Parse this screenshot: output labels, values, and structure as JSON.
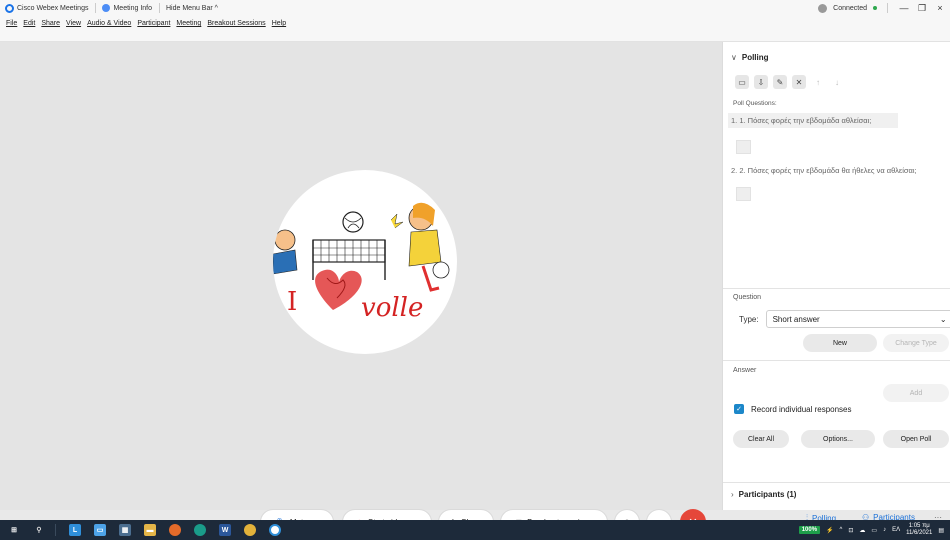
{
  "titlebar": {
    "app_name": "Cisco Webex Meetings",
    "meeting_info": "Meeting Info",
    "hide_menu": "Hide Menu Bar ^",
    "status": "Connected",
    "minimize": "—",
    "restore": "❐",
    "close": "×"
  },
  "menu": [
    "File",
    "Edit",
    "Share",
    "View",
    "Audio & Video",
    "Participant",
    "Meeting",
    "Breakout Sessions",
    "Help"
  ],
  "polling": {
    "title": "Polling",
    "poll_questions_label": "Poll Questions:",
    "questions": [
      "1. 1. Πόσες φορές την εβδομάδα αθλείσαι;",
      "2. 2. Πόσες φορές την εβδομάδα θα ήθελες να αθλείσαι;"
    ],
    "question_section": "Question",
    "type_label": "Type:",
    "type_value": "Short answer",
    "new_button": "New",
    "change_type_button": "Change Type",
    "answer_section": "Answer",
    "add_button": "Add",
    "record_label": "Record individual responses",
    "clear_all": "Clear All",
    "options": "Options...",
    "open_poll": "Open Poll",
    "participants_label": "Participants (1)"
  },
  "controls": {
    "mute": "Mute",
    "start_video": "Start video",
    "share": "Share",
    "breakout": "Breakout sessions",
    "polling_tab": "Polling",
    "participants_tab": "Participants",
    "more": "···"
  },
  "avatar_text": "I volle",
  "taskbar": {
    "battery": "100%",
    "lang": "ΕΛ",
    "time": "1:05 πμ",
    "date": "11/6/2021"
  },
  "colors": {
    "accent": "#1c71d8",
    "end_call": "#e5473a",
    "checkbox": "#1c87c9",
    "taskbar": "#1d2a3a"
  }
}
